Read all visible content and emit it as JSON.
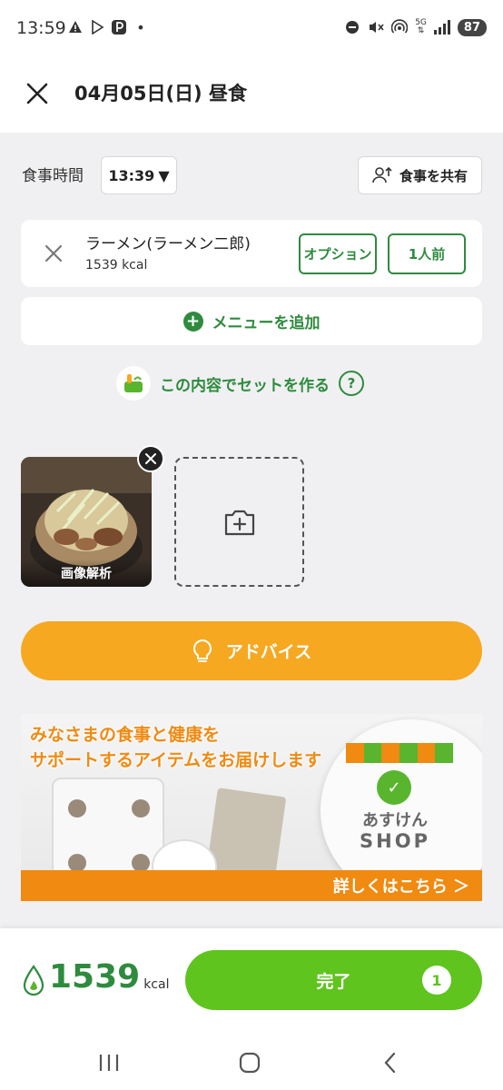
{
  "status_bar": {
    "time": "13:59",
    "network_label": "5G",
    "battery": "87"
  },
  "header": {
    "title": "04月05日(日)  昼食"
  },
  "meal_time": {
    "label": "食事時間",
    "value": "13:39",
    "dropdown_symbol": "▼"
  },
  "share": {
    "label": "食事を共有"
  },
  "menu_item": {
    "name": "ラーメン(ラーメン二郎)",
    "kcal": "1539 kcal",
    "option_label": "オプション",
    "serving_label": "1人前"
  },
  "add_menu": {
    "label": "メニューを追加"
  },
  "make_set": {
    "label": "この内容でセットを作る",
    "help_symbol": "?"
  },
  "photo": {
    "label": "画像解析"
  },
  "advice": {
    "label": "アドバイス"
  },
  "banner": {
    "line1": "みなさまの食事と健康を",
    "line2": "サポートするアイテムをお届けします",
    "shop_name_1": "あすけん",
    "shop_name_2": "SHOP",
    "cta": "詳しくはこちら ＞"
  },
  "footer": {
    "kcal_value": "1539",
    "kcal_unit": "kcal",
    "done_label": "完了",
    "done_count": "1"
  },
  "colors": {
    "brand_green": "#2e8b3e",
    "done_green": "#5fc41e",
    "advice_orange": "#f6a821",
    "banner_orange": "#f08a10",
    "background": "#f0f0f2"
  }
}
